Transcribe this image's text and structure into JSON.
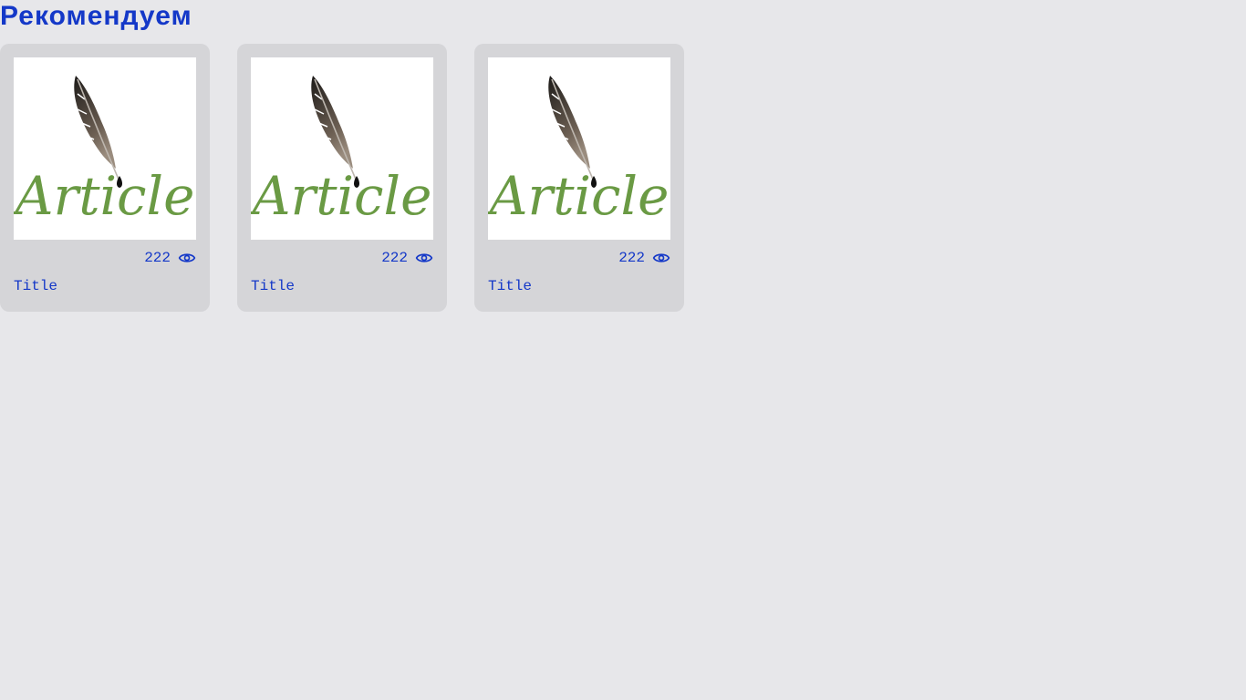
{
  "section": {
    "title": "Рекомендуем"
  },
  "logo": {
    "text": "Article",
    "text_color": "#6a9a44"
  },
  "accent_color": "#1438c8",
  "cards": [
    {
      "views": "222",
      "title": "Title",
      "icon": "eye-icon"
    },
    {
      "views": "222",
      "title": "Title",
      "icon": "eye-icon"
    },
    {
      "views": "222",
      "title": "Title",
      "icon": "eye-icon"
    }
  ]
}
